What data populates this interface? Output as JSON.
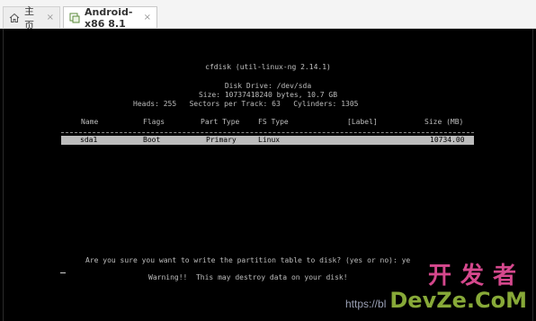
{
  "tabs": [
    {
      "label": "主页",
      "icon": "home-icon",
      "close": "×"
    },
    {
      "label": "Android-x86 8.1",
      "icon": "vm-icon",
      "close": "×"
    }
  ],
  "console": {
    "title": "cfdisk (util-linux-ng 2.14.1)",
    "disk_drive": "Disk Drive: /dev/sda",
    "size_line": "Size: 10737418240 bytes, 10.7 GB",
    "geometry": "Heads: 255   Sectors per Track: 63   Cylinders: 1305",
    "columns": [
      "Name",
      "Flags",
      "Part Type",
      "FS Type",
      "[Label]",
      "Size (MB)"
    ],
    "partitions": [
      {
        "name": "sda1",
        "flags": "Boot",
        "part_type": "Primary",
        "fs_type": "Linux",
        "label": "",
        "size_mb": "10734.00"
      }
    ],
    "prompt": "Are you sure you want to write the partition table to disk? (yes or no): ye",
    "warning": "Warning!!  This may destroy data on your disk!",
    "cursor_char": "_"
  },
  "watermark": {
    "cn": "开发者",
    "en": "DevZe.CoM",
    "url": "https://bl"
  },
  "colors": {
    "console_bg": "#000000",
    "console_text": "#bdbdbd",
    "selected_row": "#bcbcbc",
    "watermark_cn": "#e84f9a",
    "watermark_en": "#8fb33c"
  }
}
